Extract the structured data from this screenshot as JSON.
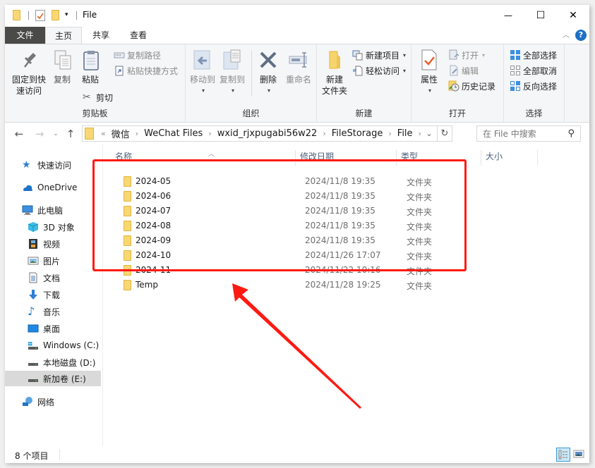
{
  "window": {
    "title": "File",
    "controls": {
      "minimize": "—",
      "maximize": "☐",
      "close": "✕"
    },
    "help_label": "?"
  },
  "ribbon_tabs": [
    {
      "label": "文件"
    },
    {
      "label": "主页"
    },
    {
      "label": "共享"
    },
    {
      "label": "查看"
    }
  ],
  "ribbon": {
    "clipboard": {
      "label": "剪贴板",
      "pin_line1": "固定到快",
      "pin_line2": "速访问",
      "copy": "复制",
      "paste": "粘贴",
      "copy_path": "复制路径",
      "paste_shortcut": "粘贴快捷方式",
      "cut": "剪切"
    },
    "organize": {
      "label": "组织",
      "move_to": "移动到",
      "copy_to": "复制到",
      "delete": "删除",
      "rename": "重命名"
    },
    "new": {
      "label": "新建",
      "new_folder_line1": "新建",
      "new_folder_line2": "文件夹",
      "new_item": "新建项目",
      "easy_access": "轻松访问"
    },
    "open": {
      "label": "打开",
      "properties": "属性",
      "open": "打开",
      "edit": "编辑",
      "history": "历史记录"
    },
    "select": {
      "label": "选择",
      "select_all": "全部选择",
      "select_none": "全部取消",
      "invert": "反向选择"
    }
  },
  "address_bar": {
    "overflow": "«",
    "crumbs": [
      "微信",
      "WeChat Files",
      "wxid_rjxpugabi56w22",
      "FileStorage",
      "File"
    ],
    "separator": "›"
  },
  "search": {
    "placeholder": "在 File 中搜索"
  },
  "nav_pane": {
    "items": [
      {
        "label": "快速访问",
        "icon": "star-icon"
      },
      {
        "label": "OneDrive",
        "icon": "cloud-icon"
      },
      {
        "label": "此电脑",
        "icon": "computer-icon"
      },
      {
        "label": "3D 对象",
        "icon": "cube-icon"
      },
      {
        "label": "视频",
        "icon": "film-icon"
      },
      {
        "label": "图片",
        "icon": "picture-icon"
      },
      {
        "label": "文档",
        "icon": "document-icon"
      },
      {
        "label": "下载",
        "icon": "download-icon"
      },
      {
        "label": "音乐",
        "icon": "music-icon"
      },
      {
        "label": "桌面",
        "icon": "desktop-icon"
      },
      {
        "label": "Windows (C:)",
        "icon": "windows-drive-icon"
      },
      {
        "label": "本地磁盘 (D:)",
        "icon": "drive-icon"
      },
      {
        "label": "新加卷 (E:)",
        "icon": "drive-icon",
        "selected": true
      },
      {
        "label": "网络",
        "icon": "network-icon"
      }
    ]
  },
  "columns": {
    "name": "名称",
    "date": "修改日期",
    "type": "类型",
    "size": "大小"
  },
  "files": [
    {
      "name": "2024-05",
      "date": "2024/11/8 19:35",
      "type": "文件夹"
    },
    {
      "name": "2024-06",
      "date": "2024/11/8 19:35",
      "type": "文件夹"
    },
    {
      "name": "2024-07",
      "date": "2024/11/8 19:35",
      "type": "文件夹"
    },
    {
      "name": "2024-08",
      "date": "2024/11/8 19:35",
      "type": "文件夹"
    },
    {
      "name": "2024-09",
      "date": "2024/11/8 19:35",
      "type": "文件夹"
    },
    {
      "name": "2024-10",
      "date": "2024/11/26 17:07",
      "type": "文件夹"
    },
    {
      "name": "2024-11",
      "date": "2024/11/22 10:16",
      "type": "文件夹"
    },
    {
      "name": "Temp",
      "date": "2024/11/28 19:25",
      "type": "文件夹"
    }
  ],
  "status_bar": {
    "item_count": "8 个项目"
  },
  "annotation": {
    "color": "#ff1a12"
  }
}
